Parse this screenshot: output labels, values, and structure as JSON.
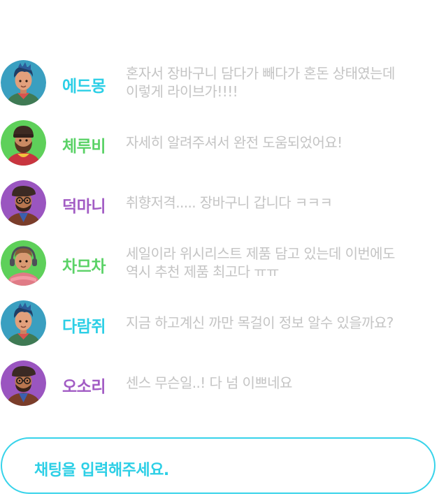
{
  "colors": {
    "cyan": "#2ccfe6",
    "green": "#5ad266",
    "purple": "#a25cc4",
    "message_gray": "#c4c4c4",
    "input_border": "#37d3ea"
  },
  "chat": {
    "messages": [
      {
        "nickname": "에드몽",
        "text": "혼자서 장바구니 담다가 빼다가 혼돈 상태였는데\n이렇게 라이브가!!!!",
        "nick_color": "#2ccfe6",
        "avatar": "avatar-blue-hair"
      },
      {
        "nickname": "체루비",
        "text": "자세히 알려주셔서 완전 도움되었어요!",
        "nick_color": "#5ad266",
        "avatar": "avatar-bearded-beanie"
      },
      {
        "nickname": "덕마니",
        "text": "취향저격..... 장바구니 갑니다 ㅋㅋㅋ",
        "nick_color": "#a25cc4",
        "avatar": "avatar-glasses-beret"
      },
      {
        "nickname": "차므차",
        "text": "세일이라 위시리스트 제품 담고 있는데 이번에도\n역시 추천 제품 최고다 ㅠㅠ",
        "nick_color": "#5ad266",
        "avatar": "avatar-headphones"
      },
      {
        "nickname": "다람쥐",
        "text": "지금 하고계신 까만 목걸이 정보 알수 있을까요?",
        "nick_color": "#2ccfe6",
        "avatar": "avatar-blue-hair"
      },
      {
        "nickname": "오소리",
        "text": "센스 무슨일..! 다 넘 이쁘네요",
        "nick_color": "#a25cc4",
        "avatar": "avatar-glasses-beret"
      }
    ]
  },
  "input": {
    "placeholder": "채팅을 입력해주세요."
  }
}
